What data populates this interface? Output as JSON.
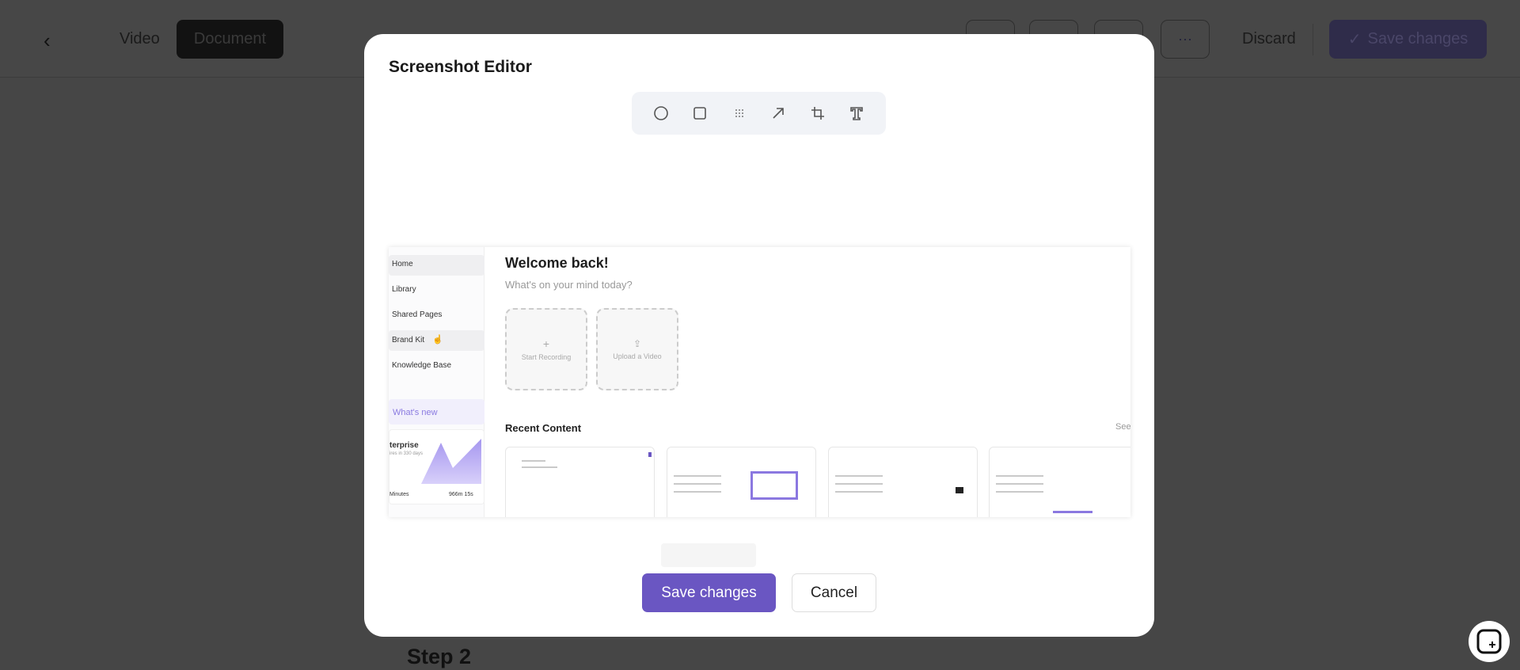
{
  "topbar": {
    "video_label": "Video",
    "document_label": "Document",
    "more_label": "···",
    "discard_label": "Discard",
    "save_label": "Save changes"
  },
  "page": {
    "step_heading": "Step 2"
  },
  "modal": {
    "title": "Screenshot Editor",
    "tools": [
      "circle",
      "rectangle",
      "blur",
      "arrow",
      "crop",
      "text"
    ],
    "save_label": "Save changes",
    "cancel_label": "Cancel",
    "embedded": {
      "sidebar": [
        "Home",
        "Library",
        "Shared Pages",
        "Brand Kit",
        "Knowledge Base"
      ],
      "whats_new": "What's new",
      "plan": "terprise",
      "plan_sub": "ires in 330 days",
      "minutes_label": "Minutes",
      "minutes_value": "966m 15s",
      "welcome": "Welcome back!",
      "subtitle": "What's on your mind today?",
      "start_recording": "Start Recording",
      "upload_video": "Upload a Video",
      "recent_content": "Recent Content",
      "see_all": "See"
    }
  },
  "colors": {
    "accent": "#6a56c2",
    "overlay": "#464646"
  }
}
